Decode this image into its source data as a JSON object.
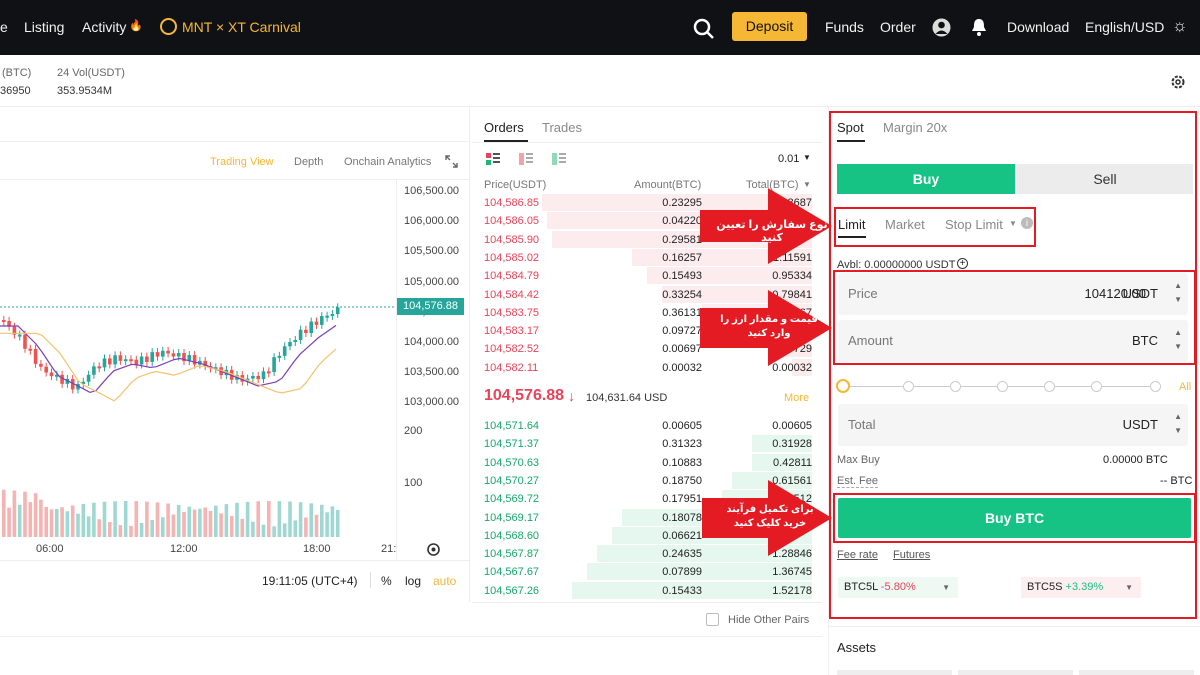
{
  "nav": {
    "items": [
      "e",
      "Listing",
      "Activity"
    ],
    "carnival": "MNT × XT Carnival",
    "deposit": "Deposit",
    "right": [
      "Funds",
      "Order",
      "Download",
      "English/USD"
    ]
  },
  "stats": {
    "unit_label": "(BTC)",
    "unit_value": "36950",
    "vol_label": "24 Vol(USDT)",
    "vol_value": "353.9534M"
  },
  "chart": {
    "tabs": [
      "Trading View",
      "Depth",
      "Onchain Analytics"
    ],
    "y_ticks": [
      "106,500.00",
      "106,000.00",
      "105,500.00",
      "105,000.00",
      "104,500.00",
      "104,000.00",
      "103,500.00",
      "103,000.00"
    ],
    "price_badge": "104,576.88",
    "vol_ticks": [
      "200",
      "100"
    ],
    "x_ticks": [
      "06:00",
      "12:00",
      "18:00",
      "21:"
    ],
    "time": "19:11:05 (UTC+4)",
    "opts": [
      "%",
      "log",
      "auto"
    ],
    "colors": {
      "up": "#26a69a",
      "down": "#ef5350",
      "accent": "#f5b734"
    }
  },
  "book": {
    "tabs": [
      "Orders",
      "Trades"
    ],
    "precision": "0.01",
    "headers": [
      "Price(USDT)",
      "Amount(BTC)",
      "Total(BTC)"
    ],
    "asks": [
      [
        "104,586.85",
        "0.23295",
        "8687"
      ],
      [
        "104,586.05",
        "0.04220",
        ""
      ],
      [
        "104,585.90",
        "0.29581",
        ""
      ],
      [
        "104,585.02",
        "0.16257",
        "1.11591"
      ],
      [
        "104,584.79",
        "0.15493",
        "0.95334"
      ],
      [
        "104,584.42",
        "0.33254",
        "0.79841"
      ],
      [
        "104,583.75",
        "0.36131",
        "67"
      ],
      [
        "104,583.17",
        "0.09727",
        "29"
      ],
      [
        "104,582.52",
        "0.00697",
        "0.00729"
      ],
      [
        "104,582.11",
        "0.00032",
        "0.00032"
      ]
    ],
    "last_price": "104,576.88",
    "last_arrow": "↓",
    "last_usd": "104,631.64 USD",
    "more": "More",
    "bids": [
      [
        "104,571.64",
        "0.00605",
        "0.00605"
      ],
      [
        "104,571.37",
        "0.31323",
        "0.31928"
      ],
      [
        "104,570.63",
        "0.10883",
        "0.42811"
      ],
      [
        "104,570.27",
        "0.18750",
        "0.61561"
      ],
      [
        "104,569.72",
        "0.17951",
        "512"
      ],
      [
        "104,569.17",
        "0.18078",
        ""
      ],
      [
        "104,568.60",
        "0.06621",
        ""
      ],
      [
        "104,567.87",
        "0.24635",
        "1.28846"
      ],
      [
        "104,567.67",
        "0.07899",
        "1.36745"
      ],
      [
        "104,567.26",
        "0.15433",
        "1.52178"
      ]
    ],
    "hide_other": "Hide Other Pairs"
  },
  "panel": {
    "tabs": [
      "Spot",
      "Margin 20x"
    ],
    "buy": "Buy",
    "sell": "Sell",
    "order_types": [
      "Limit",
      "Market",
      "Stop Limit"
    ],
    "avbl": "Avbl: 0.00000000 USDT",
    "price_label": "Price",
    "price_value": "104120.00",
    "price_unit": "USDT",
    "amount_label": "Amount",
    "amount_unit": "BTC",
    "slider_all": "All",
    "total_label": "Total",
    "total_unit": "USDT",
    "max_buy_label": "Max Buy",
    "max_buy_value": "0.00000 BTC",
    "fee_label": "Est. Fee",
    "fee_value": "-- BTC",
    "buy_btn": "Buy BTC",
    "links": [
      "Fee rate",
      "Futures"
    ],
    "lev": [
      {
        "name": "BTC5L",
        "chg": "-5.80%"
      },
      {
        "name": "BTC5S",
        "chg": "+3.39%"
      }
    ],
    "assets": "Assets"
  },
  "annotations": {
    "a1": "نوع سفارش را تعیین کنید",
    "a2": "قیمت و مقدار ارز را وارد کنید",
    "a3": "برای تکمیل فرآیند خرید کلیک کنید"
  }
}
